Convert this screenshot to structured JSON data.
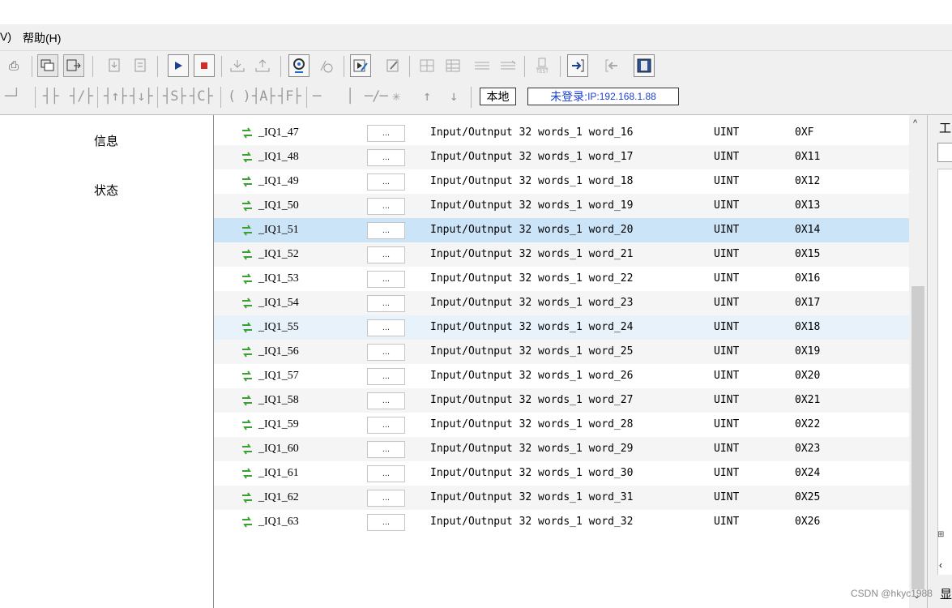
{
  "menu": {
    "partial_left": "V)",
    "help": "帮助(H)"
  },
  "toolbar": {
    "status_local": "本地",
    "status_login_prefix": "未登录:",
    "status_login_ip": "IP:192.168.1.88"
  },
  "left_panel": {
    "items": [
      {
        "label": "信息"
      },
      {
        "label": "状态"
      }
    ]
  },
  "table": {
    "ellipsis_label": "...",
    "selected_row_index": 4,
    "hover_row_index": 8,
    "rows": [
      {
        "name": "_IQ1_47",
        "desc": "Input/Outnput 32 words_1 word_16",
        "type": "UINT",
        "value": "0XF"
      },
      {
        "name": "_IQ1_48",
        "desc": "Input/Outnput 32 words_1 word_17",
        "type": "UINT",
        "value": "0X11"
      },
      {
        "name": "_IQ1_49",
        "desc": "Input/Outnput 32 words_1 word_18",
        "type": "UINT",
        "value": "0X12"
      },
      {
        "name": "_IQ1_50",
        "desc": "Input/Outnput 32 words_1 word_19",
        "type": "UINT",
        "value": "0X13"
      },
      {
        "name": "_IQ1_51",
        "desc": "Input/Outnput 32 words_1 word_20",
        "type": "UINT",
        "value": "0X14"
      },
      {
        "name": "_IQ1_52",
        "desc": "Input/Outnput 32 words_1 word_21",
        "type": "UINT",
        "value": "0X15"
      },
      {
        "name": "_IQ1_53",
        "desc": "Input/Outnput 32 words_1 word_22",
        "type": "UINT",
        "value": "0X16"
      },
      {
        "name": "_IQ1_54",
        "desc": "Input/Outnput 32 words_1 word_23",
        "type": "UINT",
        "value": "0X17"
      },
      {
        "name": "_IQ1_55",
        "desc": "Input/Outnput 32 words_1 word_24",
        "type": "UINT",
        "value": "0X18"
      },
      {
        "name": "_IQ1_56",
        "desc": "Input/Outnput 32 words_1 word_25",
        "type": "UINT",
        "value": "0X19"
      },
      {
        "name": "_IQ1_57",
        "desc": "Input/Outnput 32 words_1 word_26",
        "type": "UINT",
        "value": "0X20"
      },
      {
        "name": "_IQ1_58",
        "desc": "Input/Outnput 32 words_1 word_27",
        "type": "UINT",
        "value": "0X21"
      },
      {
        "name": "_IQ1_59",
        "desc": "Input/Outnput 32 words_1 word_28",
        "type": "UINT",
        "value": "0X22"
      },
      {
        "name": "_IQ1_60",
        "desc": "Input/Outnput 32 words_1 word_29",
        "type": "UINT",
        "value": "0X23"
      },
      {
        "name": "_IQ1_61",
        "desc": "Input/Outnput 32 words_1 word_30",
        "type": "UINT",
        "value": "0X24"
      },
      {
        "name": "_IQ1_62",
        "desc": "Input/Outnput 32 words_1 word_31",
        "type": "UINT",
        "value": "0X25"
      },
      {
        "name": "_IQ1_63",
        "desc": "Input/Outnput 32 words_1 word_32",
        "type": "UINT",
        "value": "0X26"
      }
    ]
  },
  "right_panel": {
    "title_partial": "工",
    "bottom_partial": "显"
  },
  "colors": {
    "selected_row": "#cce4f7",
    "hover_row": "#e8f2fb",
    "alt_row": "#f5f5f5",
    "sync_icon": "#3aa035",
    "login_text": "#1a3fd6"
  },
  "watermark": "CSDN @hkyc1988"
}
